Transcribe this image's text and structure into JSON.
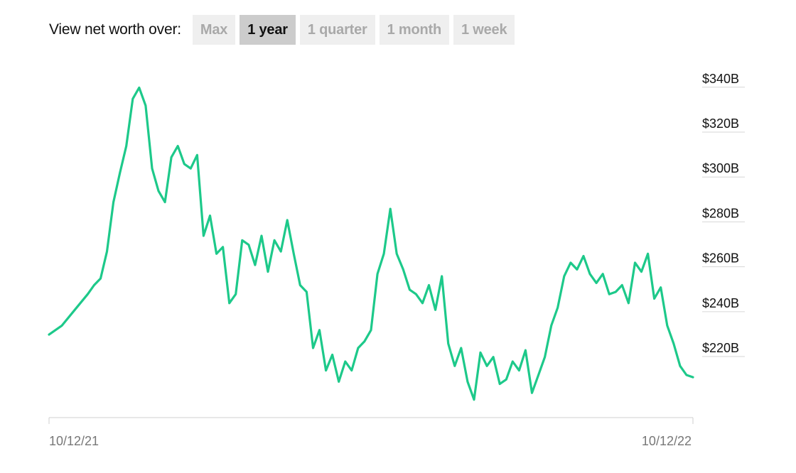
{
  "controls": {
    "label": "View net worth over:",
    "tabs": [
      {
        "label": "Max",
        "active": false
      },
      {
        "label": "1 year",
        "active": true
      },
      {
        "label": "1 quarter",
        "active": false
      },
      {
        "label": "1 month",
        "active": false
      },
      {
        "label": "1 week",
        "active": false
      }
    ]
  },
  "chart_data": {
    "type": "line",
    "title": "",
    "xlabel": "",
    "ylabel": "",
    "x_tick_labels": [
      "10/12/21",
      "10/12/22"
    ],
    "y_tick_labels": [
      "$340B",
      "$320B",
      "$300B",
      "$280B",
      "$260B",
      "$240B",
      "$220B"
    ],
    "y_ticks": [
      340,
      320,
      300,
      280,
      260,
      240,
      220
    ],
    "ylim": [
      189,
      345
    ],
    "y_unit": "billions USD",
    "line_color": "#1dc98a",
    "series": [
      {
        "name": "",
        "x": [
          0,
          2,
          4,
          6,
          7,
          8,
          9,
          10,
          11,
          12,
          13,
          14,
          15,
          16,
          17,
          18,
          19,
          20,
          21,
          22,
          23,
          24,
          25,
          26,
          27,
          28,
          29,
          30,
          31,
          32,
          33,
          34,
          35,
          36,
          37,
          38,
          39,
          40,
          41,
          42,
          43,
          44,
          45,
          46,
          47,
          48,
          49,
          50,
          51,
          52,
          53,
          54,
          55,
          56,
          57,
          58,
          59,
          60,
          61,
          62,
          63,
          64,
          65,
          66,
          67,
          68,
          69,
          70,
          71,
          72,
          73,
          74,
          75,
          76,
          77,
          78,
          79,
          80,
          81,
          82,
          83,
          84,
          85,
          86,
          87,
          88,
          89,
          90,
          91,
          92,
          93,
          94,
          95,
          96,
          97,
          98,
          99,
          100
        ],
        "values": [
          226,
          230,
          237,
          244,
          248,
          251,
          263,
          285,
          298,
          310,
          331,
          336,
          328,
          300,
          290,
          285,
          305,
          310,
          302,
          300,
          306,
          270,
          279,
          262,
          265,
          240,
          244,
          268,
          266,
          257,
          270,
          254,
          268,
          263,
          277,
          262,
          248,
          245,
          220,
          228,
          210,
          217,
          205,
          214,
          210,
          220,
          223,
          228,
          253,
          262,
          282,
          262,
          255,
          246,
          244,
          240,
          248,
          237,
          252,
          222,
          212,
          220,
          205,
          197,
          218,
          212,
          216,
          204,
          206,
          214,
          210,
          219,
          200,
          208,
          216,
          230,
          238,
          252,
          258,
          255,
          261,
          253,
          249,
          253,
          244,
          245,
          248,
          240,
          258,
          254,
          262,
          242,
          247,
          230,
          222,
          212,
          208,
          207
        ],
        "note_x": "x is percent of the one-year span from 10/12/21 to 10/12/22"
      }
    ]
  }
}
